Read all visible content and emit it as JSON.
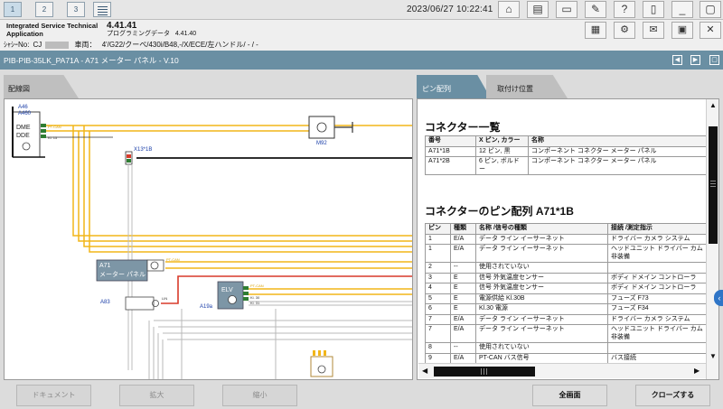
{
  "topbar": {
    "tabs": [
      "1",
      "2",
      "3"
    ],
    "datetime": "2023/06/27 10:22:41"
  },
  "header": {
    "app_name": "Integrated Service Technical Application",
    "version": "4.41.41",
    "prog_label": "プログラミングデータ",
    "prog_version": "4.41.40",
    "vin_label": "ｼｬｼｰNo:",
    "vin_value": "CJ",
    "vehicle_label": "車両：",
    "vehicle_value": "4'/G22/クーペ/430i/B48,-/X/ECE/左ハンドル/ - / -"
  },
  "titlebar": {
    "title": "PIB-PIB-35LK_PA71A - A71 メーター パネル - V.10"
  },
  "tabs": {
    "wiring": "配線図",
    "pin": "ピン配列",
    "mount": "取付け位置"
  },
  "wiring": {
    "labels": {
      "a46": "A46",
      "a46b": "A460",
      "dme": "DME",
      "dde": "DDE",
      "m92": "M92",
      "x13": "X13*1B",
      "a71": "A71",
      "a71_name": "メーター パネル",
      "elv": "ELV",
      "a83": "A83",
      "a19": "A19a",
      "kl15": "Kl. 15",
      "ptcan": "PT-CAN",
      "kl30": "Kl. 30",
      "kl31": "Kl. 31",
      "lin": "LIN"
    }
  },
  "doc": {
    "connector_list_title": "コネクター一覧",
    "connector_headers": [
      "番号",
      "X ピン, カラー",
      "名称"
    ],
    "connectors": [
      [
        "A71*1B",
        "12 ピン, 黒",
        "コンポーネント コネクター メーター パネル"
      ],
      [
        "A71*2B",
        "6 ピン, ボルドー",
        "コンポーネント コネクター メーター パネル"
      ]
    ],
    "pin_title": "コネクターのピン配列 A71*1B",
    "pin_headers": [
      "ピン",
      "種類",
      "名称 /信号の種類",
      "接続 /測定指示"
    ],
    "pins": [
      [
        "1",
        "E/A",
        "データ ライン イーサーネット",
        "ドライバー カメラ システム"
      ],
      [
        "1",
        "E/A",
        "データ ライン イーサーネット",
        "ヘッドユニット ドライバー カム非装備"
      ],
      [
        "2",
        "--",
        "使用されていない",
        ""
      ],
      [
        "3",
        "E",
        "信号 外気温度センサー",
        "ボディ ドメイン コントローラ"
      ],
      [
        "4",
        "E",
        "信号 外気温度センサー",
        "ボディ ドメイン コントローラ"
      ],
      [
        "5",
        "E",
        "電源供給 Kl.30B",
        "フューズ F73"
      ],
      [
        "6",
        "E",
        "Kl.30 電源",
        "フューズ F34"
      ],
      [
        "7",
        "E/A",
        "データ ライン イーサーネット",
        "ドライバー カメラ システム"
      ],
      [
        "7",
        "E/A",
        "データ ライン イーサーネット",
        "ヘッドユニット ドライバー カム非装備"
      ],
      [
        "8",
        "--",
        "使用されていない",
        ""
      ],
      [
        "9",
        "E/A",
        "PT-CAN バス信号",
        "バス接続"
      ]
    ]
  },
  "bottom": {
    "document": "ドキュメント",
    "zoom_in": "拡大",
    "zoom_out": "縮小",
    "fullscreen": "全画面",
    "close": "クローズする"
  },
  "colors": {
    "accent": "#6a8fa3",
    "wire_yellow": "#f2b619",
    "wire_red": "#d83a2a",
    "module": "#7d96a6"
  }
}
